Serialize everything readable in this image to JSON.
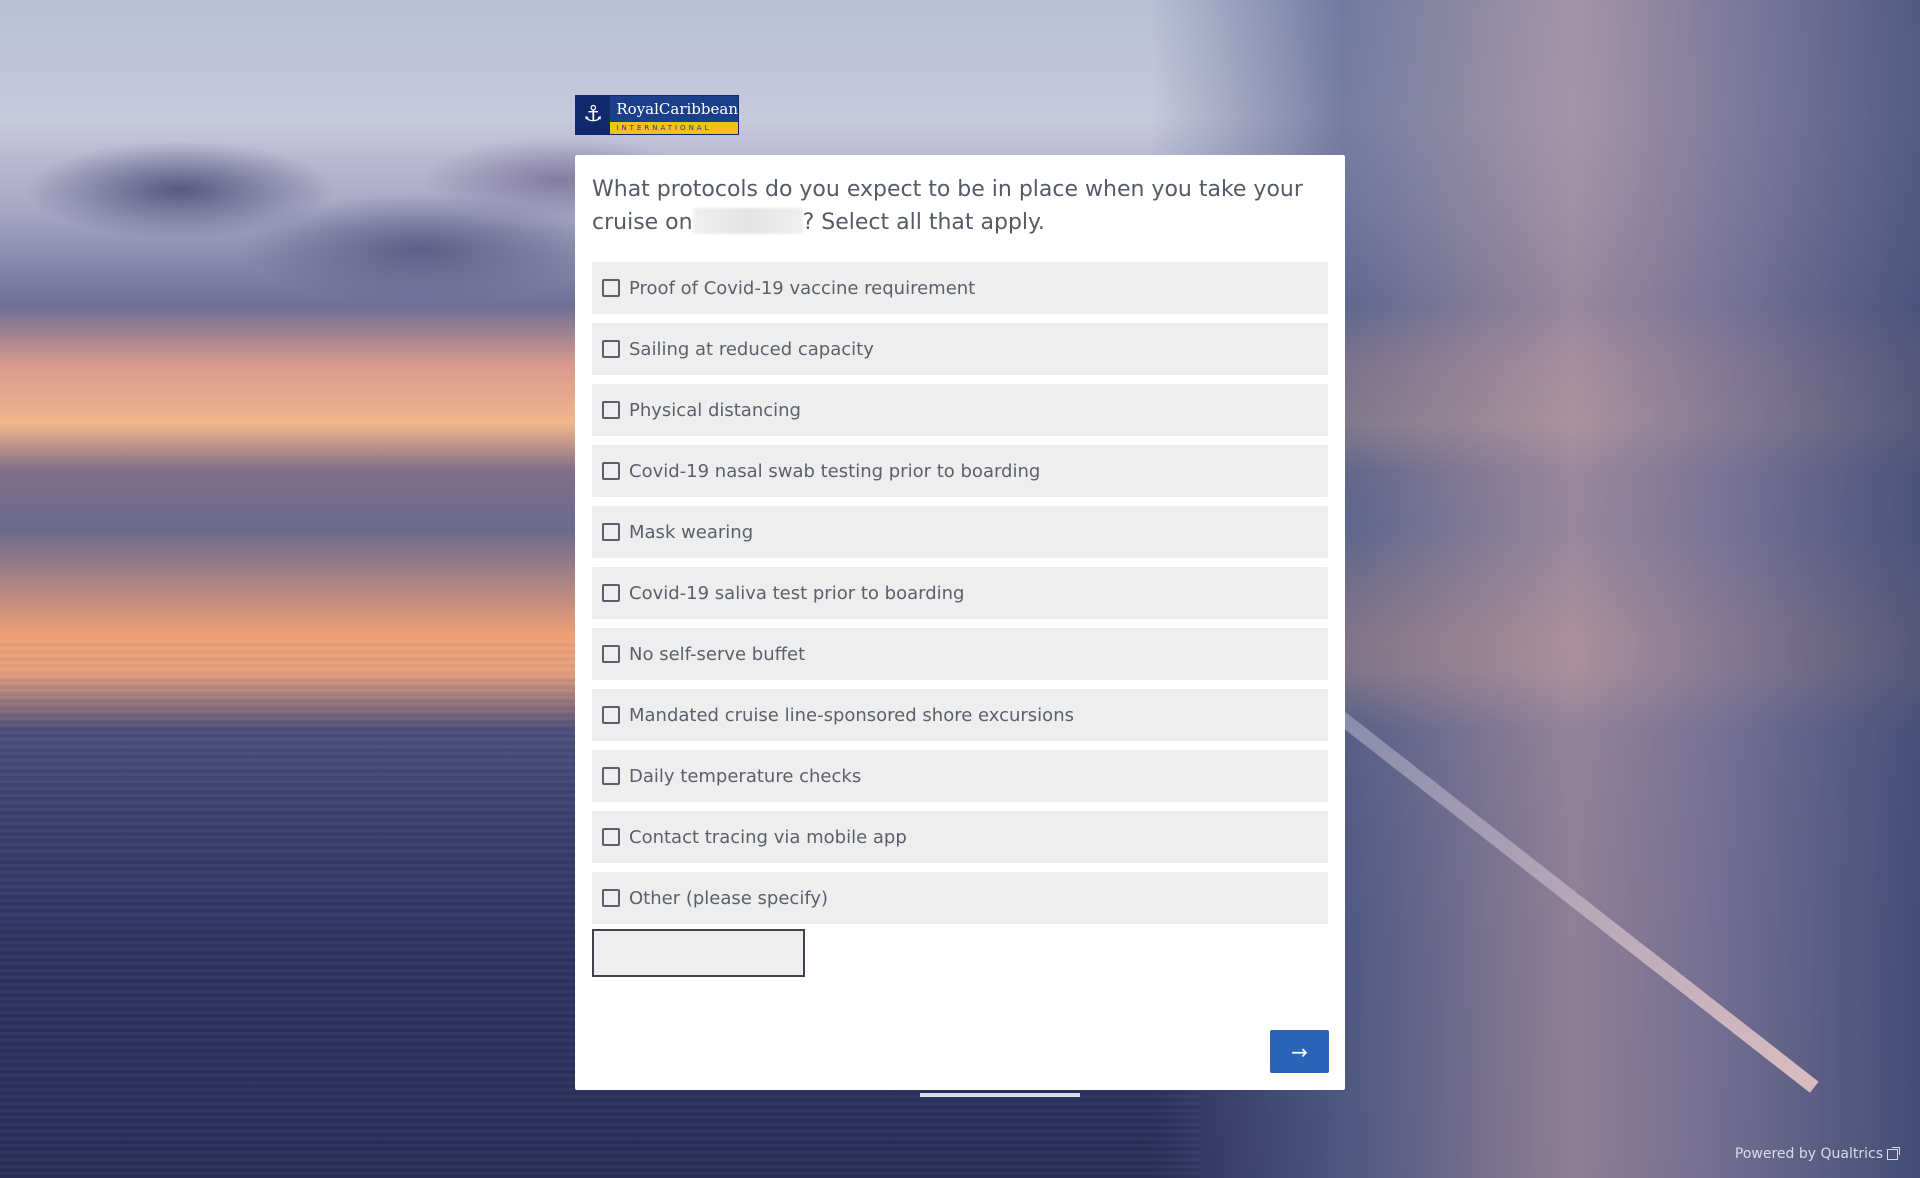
{
  "logo": {
    "name": "RoyalCaribbean",
    "sub": "INTERNATIONAL",
    "mark": "⚓"
  },
  "question": {
    "text_before": "What protocols do you expect to be in place when you take your cruise on",
    "text_after": "? Select all that apply."
  },
  "choices": [
    {
      "label": "Proof of Covid-19 vaccine requirement"
    },
    {
      "label": "Sailing at reduced capacity"
    },
    {
      "label": "Physical distancing"
    },
    {
      "label": "Covid-19 nasal swab testing prior to boarding"
    },
    {
      "label": "Mask wearing"
    },
    {
      "label": "Covid-19 saliva test prior to boarding"
    },
    {
      "label": "No self-serve buffet"
    },
    {
      "label": "Mandated cruise line-sponsored shore excursions"
    },
    {
      "label": "Daily temperature checks"
    },
    {
      "label": "Contact tracing via mobile app"
    },
    {
      "label": "Other (please specify)"
    }
  ],
  "other_input": {
    "value": "",
    "placeholder": ""
  },
  "next_button": {
    "label": "→"
  },
  "footer": {
    "powered_by": "Powered by Qualtrics"
  },
  "colors": {
    "accent": "#2c64b7",
    "card": "#ffffff",
    "choice_bg": "#eeeeee"
  }
}
